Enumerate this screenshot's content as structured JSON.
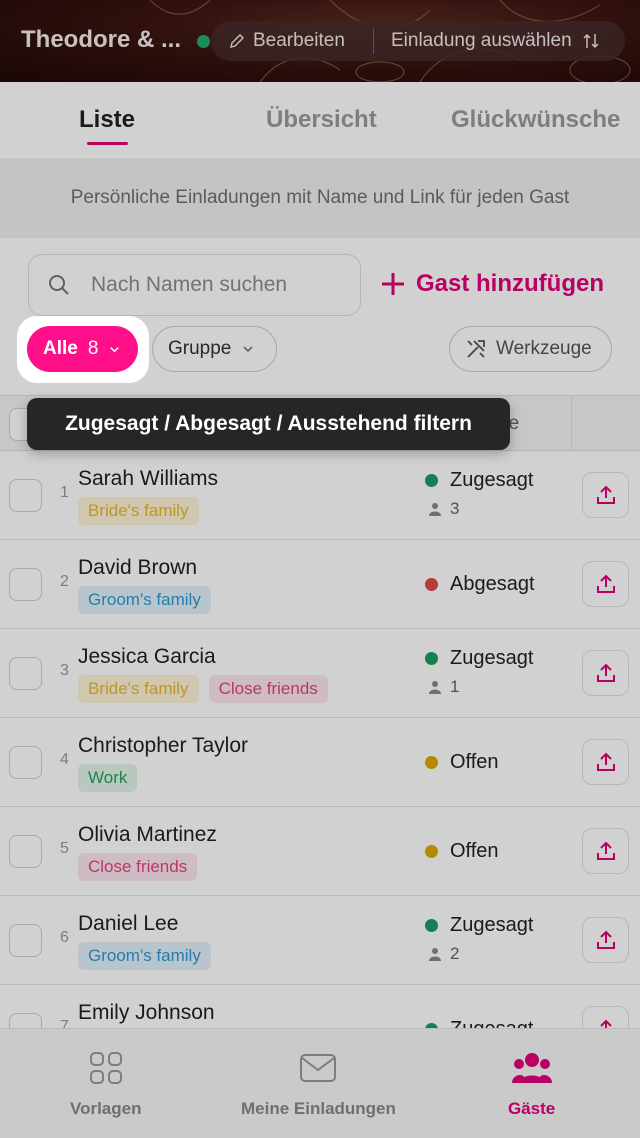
{
  "header": {
    "title": "Theodore & ...",
    "edit_label": "Bearbeiten",
    "select_invite_label": "Einladung auswählen"
  },
  "tabs": [
    {
      "label": "Liste",
      "active": true
    },
    {
      "label": "Übersicht",
      "active": false
    },
    {
      "label": "Glückwünsche",
      "active": false
    }
  ],
  "banner": "Persönliche Einladungen mit Name und Link für jeden Gast",
  "search": {
    "placeholder": "Nach Namen suchen"
  },
  "add_guest_label": "Gast hinzufügen",
  "filters": {
    "all_label": "Alle",
    "all_count": "8",
    "group_label": "Gruppe",
    "tools_label": "Werkzeuge"
  },
  "tooltip": "Zugesagt / Abgesagt / Ausstehend filtern",
  "table_header_partial": "ge",
  "guests": [
    {
      "num": "1",
      "name": "Sarah Williams",
      "tags": [
        "Bride's family"
      ],
      "status": "Zugesagt",
      "status_color": "#1a9e63",
      "persons": "3"
    },
    {
      "num": "2",
      "name": "David Brown",
      "tags": [
        "Groom's family"
      ],
      "status": "Abgesagt",
      "status_color": "#e04848",
      "persons": ""
    },
    {
      "num": "3",
      "name": "Jessica Garcia",
      "tags": [
        "Bride's family",
        "Close friends"
      ],
      "status": "Zugesagt",
      "status_color": "#1a9e63",
      "persons": "1"
    },
    {
      "num": "4",
      "name": "Christopher Taylor",
      "tags": [
        "Work"
      ],
      "status": "Offen",
      "status_color": "#e0a800",
      "persons": ""
    },
    {
      "num": "5",
      "name": "Olivia Martinez",
      "tags": [
        "Close friends"
      ],
      "status": "Offen",
      "status_color": "#e0a800",
      "persons": ""
    },
    {
      "num": "6",
      "name": "Daniel Lee",
      "tags": [
        "Groom's family"
      ],
      "status": "Zugesagt",
      "status_color": "#1a9e63",
      "persons": "2"
    },
    {
      "num": "7",
      "name": "Emily Johnson",
      "tags": [],
      "status": "Zugesagt",
      "status_color": "#1a9e63",
      "persons": ""
    }
  ],
  "tag_colors": {
    "Bride's family": {
      "bg": "#fdf3d6",
      "fg": "#e8b632"
    },
    "Groom's family": {
      "bg": "#e2f1fb",
      "fg": "#2d9ad3"
    },
    "Close friends": {
      "bg": "#fde4ee",
      "fg": "#e0447e"
    },
    "Work": {
      "bg": "#e2f4ea",
      "fg": "#2b9a5c"
    }
  },
  "bottom_nav": [
    {
      "label": "Vorlagen",
      "icon": "templates-grid-icon",
      "active": false
    },
    {
      "label": "Meine Einladungen",
      "icon": "envelope-icon",
      "active": false
    },
    {
      "label": "Gäste",
      "icon": "guests-group-icon",
      "active": true
    }
  ],
  "accent_color": "#e2007a"
}
